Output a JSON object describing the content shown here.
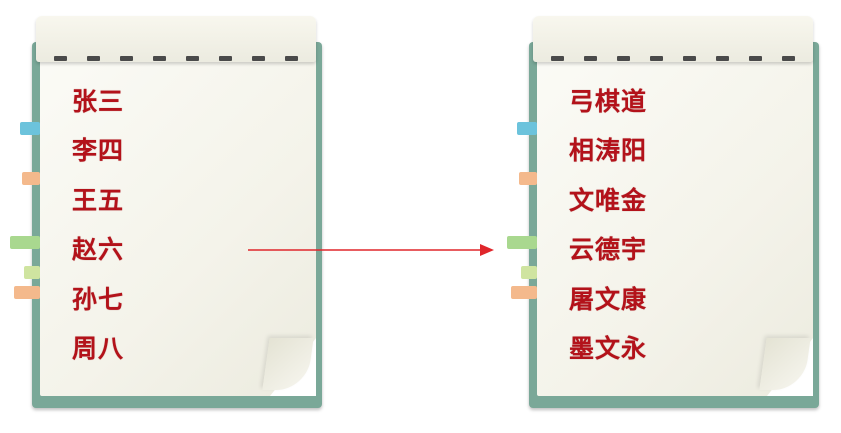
{
  "left_notebook": {
    "names": [
      "张三",
      "李四",
      "王五",
      "赵六",
      "孙七",
      "周八"
    ]
  },
  "right_notebook": {
    "names": [
      "弓棋道",
      "相涛阳",
      "文唯金",
      "云德宇",
      "屠文康",
      "墨文永"
    ]
  },
  "colors": {
    "name_text": "#b3121a",
    "notebook_cover": "#7aa898",
    "arrow": "#e0262b",
    "tab_blue": "#6cc3dc",
    "tab_orange": "#f4b98c",
    "tab_green": "#a9d88f",
    "tab_lightgreen": "#cfe4a0"
  },
  "icons": {
    "arrow": "right-arrow-icon"
  }
}
